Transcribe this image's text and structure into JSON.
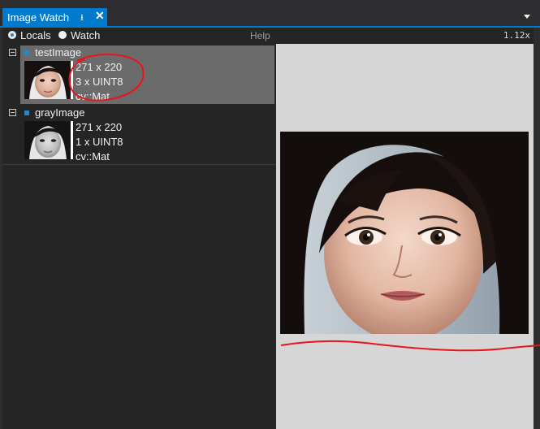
{
  "window": {
    "tab_title": "Image Watch",
    "pin_glyph": "↕",
    "close_glyph": "✕",
    "dropdown_icon": "chevron-down-icon"
  },
  "toolbar": {
    "locals_label": "Locals",
    "watch_label": "Watch",
    "help_label": "Help",
    "selected": "Locals"
  },
  "variables": [
    {
      "name": "testImage",
      "size": "271 x 220",
      "channels": "3 x UINT8",
      "type": "cv::Mat",
      "selected": true,
      "color": "#1e8ad6"
    },
    {
      "name": "grayImage",
      "size": "271 x 220",
      "channels": "1 x UINT8",
      "type": "cv::Mat",
      "selected": false,
      "color": "#1e8ad6"
    }
  ],
  "viewer": {
    "zoom": "1.12x"
  },
  "colors": {
    "accent": "#007acc",
    "panel": "#252526",
    "selection": "#6b6b6b",
    "annotation": "#e8141c"
  }
}
